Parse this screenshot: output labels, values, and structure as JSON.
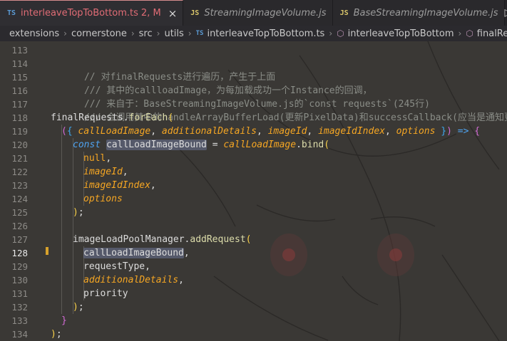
{
  "tabs": [
    {
      "icon": "TS",
      "name": "interleaveTopToBottom.ts",
      "badge": "2, M",
      "close": "×",
      "active": true
    },
    {
      "icon": "JS",
      "name": "StreamingImageVolume.js",
      "active": false
    },
    {
      "icon": "JS",
      "name": "BaseStreamingImageVolume.js",
      "active": false
    }
  ],
  "run_button": "▷",
  "breadcrumb": {
    "parts": [
      "extensions",
      "cornerstone",
      "src",
      "utils"
    ],
    "file_icon": "TS",
    "file": "interleaveTopToBottom.ts",
    "symbol1": "interleaveTopToBottom",
    "symbol2": "finalRequests.for"
  },
  "line_numbers": [
    "113",
    "114",
    "115",
    "116",
    "117",
    "118",
    "119",
    "120",
    "121",
    "122",
    "123",
    "124",
    "125",
    "126",
    "127",
    "128",
    "129",
    "130",
    "131",
    "132",
    "133",
    "134"
  ],
  "current_line": "128",
  "code": {
    "l114": "// 对finalRequests进行遍历，产生于上面",
    "l115": "/// 其中的callloadImage，为每加载成功一个Instance的回调，",
    "l116": "/// 来自于：BaseStreamingImageVolume.js的`const requests`(245行)",
    "l117": "/// 会调用其中的handleArrayBufferLoad(更新PixelData)和successCallback(应当是通知更新)",
    "t_finalRequests": "finalRequests",
    "t_dot": ".",
    "t_forEach": "forEach",
    "t_lparen": "(",
    "t_rparen": ")",
    "t_lbrace": "{",
    "t_rbrace": "}",
    "t_space": " ",
    "t_comma": ",",
    "t_semi": ";",
    "t_arrow": "=>",
    "t_eq": "=",
    "t_callLoadImage": "callLoadImage",
    "t_additionalDetails": "additionalDetails",
    "t_imageId": "imageId",
    "t_imageIdIndex": "imageIdIndex",
    "t_options": "options",
    "t_const": "const",
    "t_callLoadImageBound": "callLoadImageBound",
    "t_bind": "bind",
    "t_null": "null",
    "t_imageLoadPoolManager": "imageLoadPoolManager",
    "t_addRequest": "addRequest",
    "t_requestType": "requestType",
    "t_priority": "priority"
  },
  "colors": {
    "comment": "#8a8d87",
    "keyword": "#4fa3f0",
    "function": "#dcdcaa",
    "parameter": "#f5a623",
    "modified_tab": "#e06c75",
    "gutter_modified": "#d7a12b"
  }
}
